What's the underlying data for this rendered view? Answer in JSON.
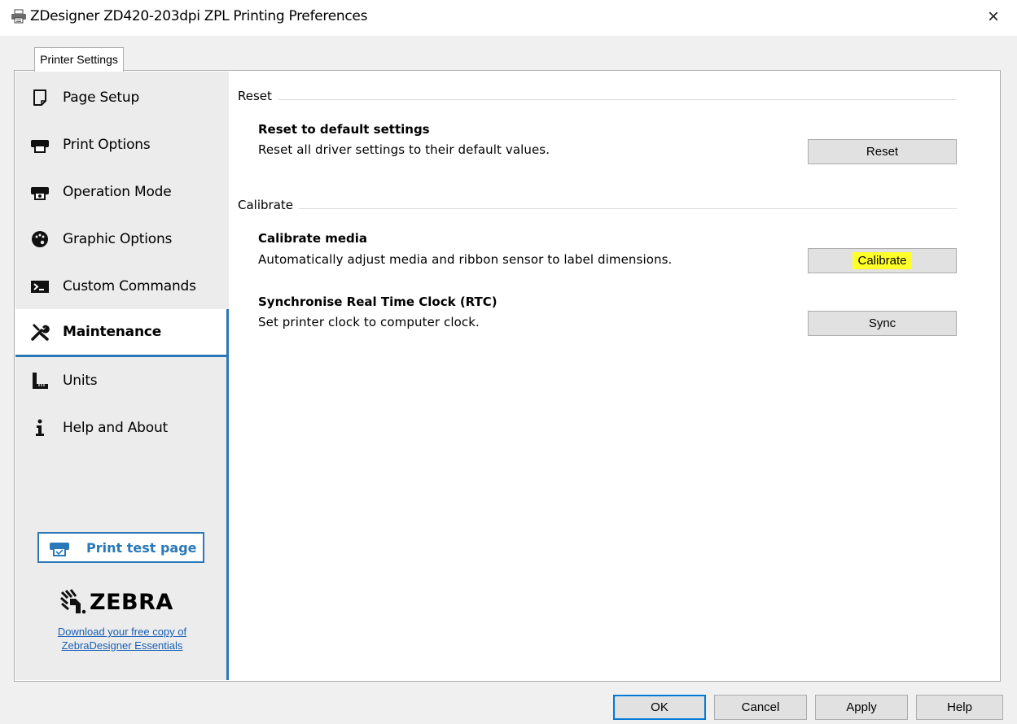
{
  "window": {
    "title": "ZDesigner ZD420-203dpi ZPL Printing Preferences",
    "close_glyph": "×"
  },
  "tab": {
    "label": "Printer Settings"
  },
  "sidebar": {
    "items": [
      {
        "label": "Page Setup",
        "icon": "page-icon"
      },
      {
        "label": "Print Options",
        "icon": "printer-icon"
      },
      {
        "label": "Operation Mode",
        "icon": "printer-mode-icon"
      },
      {
        "label": "Graphic Options",
        "icon": "palette-icon"
      },
      {
        "label": "Custom Commands",
        "icon": "terminal-icon"
      },
      {
        "label": "Maintenance",
        "icon": "tools-icon",
        "active": true
      },
      {
        "label": "Units",
        "icon": "ruler-icon"
      },
      {
        "label": "Help and About",
        "icon": "info-icon"
      }
    ],
    "test_page_label": "Print test page",
    "brand": "ZEBRA",
    "download_line1": "Download your free copy of",
    "download_line2": "ZebraDesigner Essentials"
  },
  "main": {
    "reset_section": {
      "title": "Reset",
      "item_title": "Reset to default settings",
      "item_desc": "Reset all driver settings to their default values.",
      "button": "Reset"
    },
    "calibrate_section": {
      "title": "Calibrate",
      "calibrate_title": "Calibrate media",
      "calibrate_desc": "Automatically adjust media and ribbon sensor to label dimensions.",
      "calibrate_button": "Calibrate",
      "sync_title": "Synchronise Real Time Clock (RTC)",
      "sync_desc": "Set printer clock to computer clock.",
      "sync_button": "Sync"
    }
  },
  "footer": {
    "ok": "OK",
    "cancel": "Cancel",
    "apply": "Apply",
    "help": "Help"
  },
  "colors": {
    "accent": "#2b78b8",
    "highlight": "#ffff2a"
  }
}
